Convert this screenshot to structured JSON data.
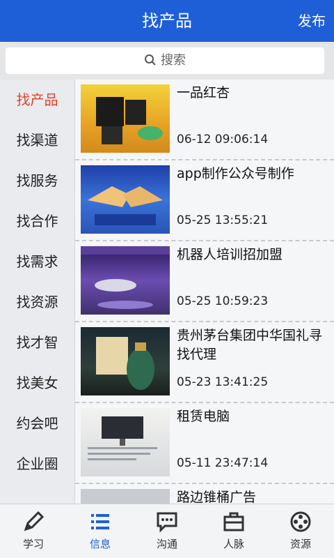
{
  "header": {
    "title": "找产品",
    "publish": "发布"
  },
  "search": {
    "placeholder": "搜索"
  },
  "sidebar": {
    "items": [
      {
        "label": "找产品",
        "active": true
      },
      {
        "label": "找渠道"
      },
      {
        "label": "找服务"
      },
      {
        "label": "找合作"
      },
      {
        "label": "找需求"
      },
      {
        "label": "找资源"
      },
      {
        "label": "找才智"
      },
      {
        "label": "找美女"
      },
      {
        "label": "约会吧"
      },
      {
        "label": "企业圈"
      }
    ]
  },
  "list": {
    "items": [
      {
        "title": "一品红杏",
        "time": "06-12 09:06:14"
      },
      {
        "title": "app制作公众号制作",
        "time": "05-25 13:55:21"
      },
      {
        "title": "机器人培训招加盟",
        "time": "05-25 10:59:23"
      },
      {
        "title": "贵州茅台集团中华国礼寻找代理",
        "time": "05-23 13:41:25"
      },
      {
        "title": "租赁电脑",
        "time": "05-11 23:47:14"
      },
      {
        "title": "路边锥桶广告",
        "time": ""
      }
    ]
  },
  "tabbar": {
    "items": [
      {
        "label": "学习",
        "icon": "pencil-icon"
      },
      {
        "label": "信息",
        "icon": "list-icon",
        "active": true
      },
      {
        "label": "沟通",
        "icon": "chat-icon"
      },
      {
        "label": "人脉",
        "icon": "briefcase-icon"
      },
      {
        "label": "资源",
        "icon": "resource-icon"
      }
    ]
  },
  "colors": {
    "brand": "#1e5fd8",
    "active_side": "#e0422d"
  }
}
